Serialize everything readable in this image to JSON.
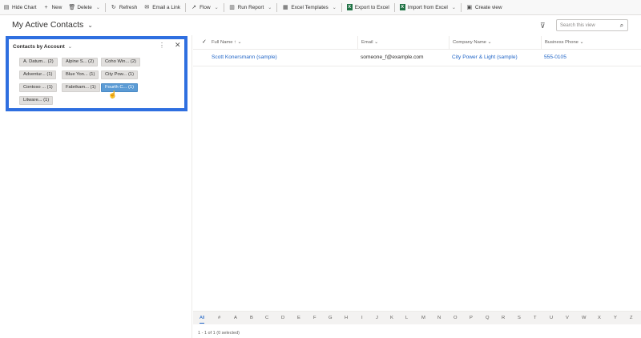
{
  "toolbar": {
    "hide_chart": "Hide Chart",
    "new": "New",
    "delete": "Delete",
    "refresh": "Refresh",
    "email_link": "Email a Link",
    "flow": "Flow",
    "run_report": "Run Report",
    "excel_templates": "Excel Templates",
    "export_excel": "Export to Excel",
    "import_excel": "Import from Excel",
    "create_view": "Create view"
  },
  "view": {
    "title": "My Active Contacts",
    "search_placeholder": "Search this view"
  },
  "chart": {
    "title": "Contacts by Account",
    "tags": [
      "A. Datum... (2)",
      "Alpine S... (2)",
      "Coho Win... (2)",
      "Adventur... (1)",
      "Blue Yon... (1)",
      "City Pow... (1)",
      "Contoso ... (1)",
      "Fabrikam... (1)",
      "Fourth C... (1)",
      "Litware... (1)"
    ],
    "selected_tag": "Fourth C... (1)"
  },
  "grid": {
    "columns": [
      "Full Name",
      "Email",
      "Company Name",
      "Business Phone"
    ],
    "rows": [
      {
        "full_name": "Scott Konersmann (sample)",
        "email": "someone_f@example.com",
        "company": "City Power & Light (sample)",
        "phone": "555-0105"
      }
    ]
  },
  "alphabet": [
    "All",
    "#",
    "A",
    "B",
    "C",
    "D",
    "E",
    "F",
    "G",
    "H",
    "I",
    "J",
    "K",
    "L",
    "M",
    "N",
    "O",
    "P",
    "Q",
    "R",
    "S",
    "T",
    "U",
    "V",
    "W",
    "X",
    "Y",
    "Z"
  ],
  "footer": {
    "record_count": "1 - 1 of 1 (0 selected)"
  },
  "colors": {
    "accent": "#2f6fe0",
    "link": "#2266c7",
    "selected_tag": "#5b9bd5"
  }
}
